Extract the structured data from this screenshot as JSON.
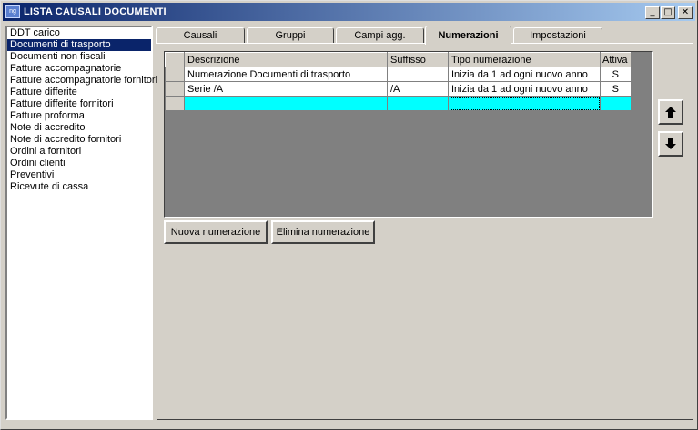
{
  "window": {
    "title": "LISTA CAUSALI DOCUMENTI",
    "icon_text": "ng",
    "minimize": "_",
    "maximize": "□",
    "close": "✕"
  },
  "causali_list": {
    "selected_index": 1,
    "items": [
      "DDT carico",
      "Documenti di trasporto",
      "Documenti non fiscali",
      "Fatture accompagnatorie",
      "Fatture accompagnatorie fornitori",
      "Fatture differite",
      "Fatture differite fornitori",
      "Fatture proforma",
      "Note di accredito",
      "Note di accredito fornitori",
      "Ordini a fornitori",
      "Ordini clienti",
      "Preventivi",
      "Ricevute di cassa"
    ]
  },
  "tabs": [
    {
      "label": "Causali",
      "active": false
    },
    {
      "label": "Gruppi",
      "active": false
    },
    {
      "label": "Campi agg.",
      "active": false
    },
    {
      "label": "Numerazioni",
      "active": true
    },
    {
      "label": "Impostazioni",
      "active": false
    }
  ],
  "grid": {
    "columns": [
      "Descrizione",
      "Suffisso",
      "Tipo numerazione",
      "Attiva"
    ],
    "rows": [
      [
        "Numerazione Documenti di trasporto",
        "",
        "Inizia da 1 ad ogni nuovo anno",
        "S"
      ],
      [
        "Serie /A",
        "/A",
        "Inizia da 1 ad ogni nuovo anno",
        "S"
      ]
    ]
  },
  "buttons": {
    "new": "Nuova numerazione",
    "delete": "Elimina numerazione",
    "up_icon": "arrow-up-icon",
    "down_icon": "arrow-down-icon"
  },
  "colors": {
    "title_start": "#0a246a",
    "title_end": "#a6caf0",
    "selection": "#0a246a",
    "new_row": "#00ffff",
    "grid_background": "#808080"
  }
}
